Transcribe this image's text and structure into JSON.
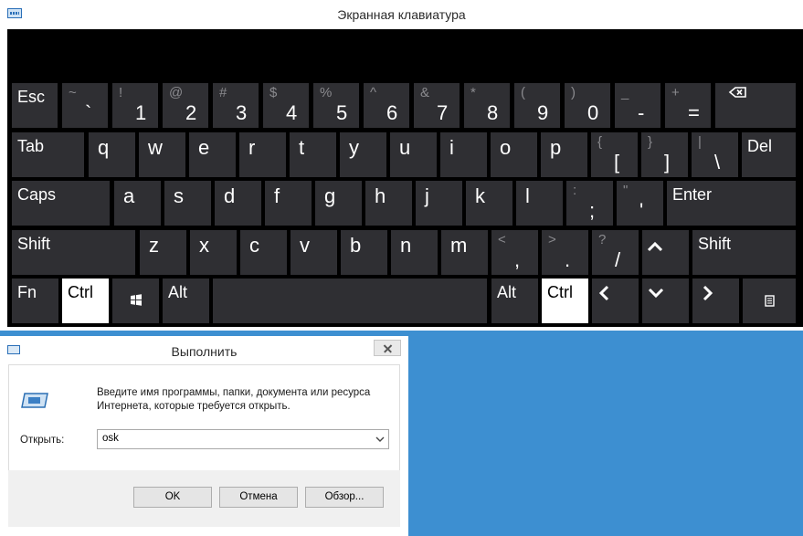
{
  "osk": {
    "title": "Экранная клавиатура",
    "rows": [
      [
        {
          "name": "Esc"
        },
        {
          "shift": "~",
          "main": "`"
        },
        {
          "shift": "!",
          "main": "1"
        },
        {
          "shift": "@",
          "main": "2"
        },
        {
          "shift": "#",
          "main": "3"
        },
        {
          "shift": "$",
          "main": "4"
        },
        {
          "shift": "%",
          "main": "5"
        },
        {
          "shift": "^",
          "main": "6"
        },
        {
          "shift": "&",
          "main": "7"
        },
        {
          "shift": "*",
          "main": "8"
        },
        {
          "shift": "(",
          "main": "9"
        },
        {
          "shift": ")",
          "main": "0"
        },
        {
          "shift": "_",
          "main": "-"
        },
        {
          "shift": "+",
          "main": "="
        },
        {
          "icon": "backspace-icon"
        }
      ],
      [
        {
          "name": "Tab"
        },
        {
          "main": "q"
        },
        {
          "main": "w"
        },
        {
          "main": "e"
        },
        {
          "main": "r"
        },
        {
          "main": "t"
        },
        {
          "main": "y"
        },
        {
          "main": "u"
        },
        {
          "main": "i"
        },
        {
          "main": "o"
        },
        {
          "main": "p"
        },
        {
          "shift": "{",
          "main": "["
        },
        {
          "shift": "}",
          "main": "]"
        },
        {
          "shift": "|",
          "main": "\\"
        },
        {
          "name": "Del"
        }
      ],
      [
        {
          "name": "Caps"
        },
        {
          "main": "a"
        },
        {
          "main": "s"
        },
        {
          "main": "d"
        },
        {
          "main": "f"
        },
        {
          "main": "g"
        },
        {
          "main": "h"
        },
        {
          "main": "j"
        },
        {
          "main": "k"
        },
        {
          "main": "l"
        },
        {
          "shift": ":",
          "main": ";"
        },
        {
          "shift": "\"",
          "main": "'"
        },
        {
          "name": "Enter"
        }
      ],
      [
        {
          "name": "Shift"
        },
        {
          "main": "z"
        },
        {
          "main": "x"
        },
        {
          "main": "c"
        },
        {
          "main": "v"
        },
        {
          "main": "b"
        },
        {
          "main": "n"
        },
        {
          "main": "m"
        },
        {
          "shift": "<",
          "main": ","
        },
        {
          "shift": ">",
          "main": "."
        },
        {
          "shift": "?",
          "main": "/"
        },
        {
          "icon": "arrow-up-icon"
        },
        {
          "name": "Shift"
        }
      ],
      [
        {
          "name": "Fn"
        },
        {
          "name": "Ctrl",
          "highlighted": true
        },
        {
          "icon": "windows-logo-icon"
        },
        {
          "name": "Alt"
        },
        {
          "name": ""
        },
        {
          "name": "Alt"
        },
        {
          "name": "Ctrl",
          "highlighted": true
        },
        {
          "icon": "arrow-left-icon"
        },
        {
          "icon": "arrow-down-icon"
        },
        {
          "icon": "arrow-right-icon"
        },
        {
          "icon": "menu-key-icon"
        }
      ]
    ]
  },
  "run": {
    "title": "Выполнить",
    "description": "Введите имя программы, папки, документа или ресурса Интернета, которые требуется открыть.",
    "open_label": "Открыть:",
    "open_value": "osk",
    "ok_label": "OK",
    "cancel_label": "Отмена",
    "browse_label": "Обзор..."
  },
  "colors": {
    "desktop": "#3d8fd1",
    "key": "#2f2f33",
    "key_highlight": "#ffffff",
    "keyboard_bg": "#000000"
  }
}
